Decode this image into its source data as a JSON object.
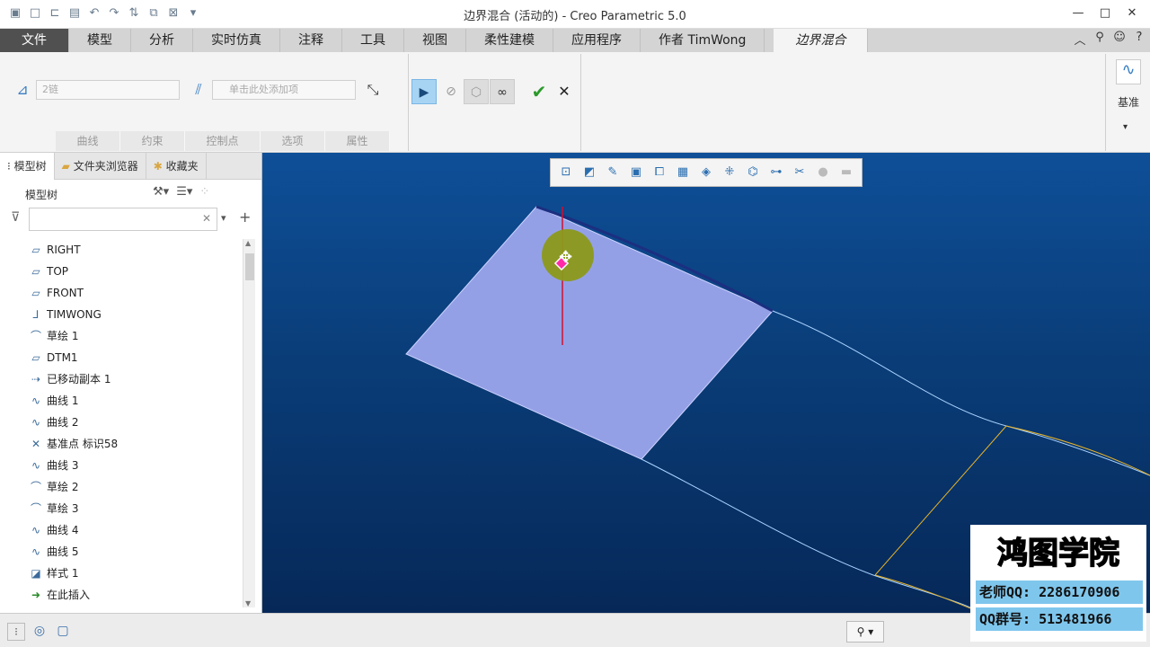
{
  "window": {
    "title": "边界混合 (活动的) - Creo Parametric 5.0"
  },
  "tabs": [
    "文件",
    "模型",
    "分析",
    "实时仿真",
    "注释",
    "工具",
    "视图",
    "柔性建模",
    "应用程序",
    "作者 TimWong",
    "边界混合"
  ],
  "ribbon": {
    "chain_field": "2链",
    "add_field": "单击此处添加项",
    "groups": [
      "曲线",
      "约束",
      "控制点",
      "选项",
      "属性"
    ],
    "datum_label": "基准"
  },
  "panel": {
    "tabs": [
      "模型树",
      "文件夹浏览器",
      "收藏夹"
    ],
    "title": "模型树",
    "items": [
      {
        "icon": "plane-icon",
        "label": "RIGHT"
      },
      {
        "icon": "plane-icon",
        "label": "TOP"
      },
      {
        "icon": "plane-icon",
        "label": "FRONT"
      },
      {
        "icon": "csys-icon",
        "label": "TIMWONG"
      },
      {
        "icon": "sketch-icon",
        "label": "草绘 1"
      },
      {
        "icon": "plane-icon",
        "label": "DTM1"
      },
      {
        "icon": "copy-icon",
        "label": "已移动副本 1"
      },
      {
        "icon": "curve-icon",
        "label": "曲线 1"
      },
      {
        "icon": "curve-icon",
        "label": "曲线 2"
      },
      {
        "icon": "datum-point-icon",
        "label": "基准点 标识58"
      },
      {
        "icon": "curve-icon",
        "label": "曲线 3"
      },
      {
        "icon": "sketch-icon",
        "label": "草绘 2"
      },
      {
        "icon": "sketch-icon",
        "label": "草绘 3"
      },
      {
        "icon": "curve-icon",
        "label": "曲线 4"
      },
      {
        "icon": "curve-icon",
        "label": "曲线 5"
      },
      {
        "icon": "style-icon",
        "label": "样式 1"
      },
      {
        "icon": "insert-arrow-icon",
        "label": "在此插入"
      }
    ]
  },
  "watermark": {
    "title": "鸿图学院",
    "teacher_qq": "老师QQ: 2286170906",
    "group_qq": "QQ群号: 513481966"
  }
}
